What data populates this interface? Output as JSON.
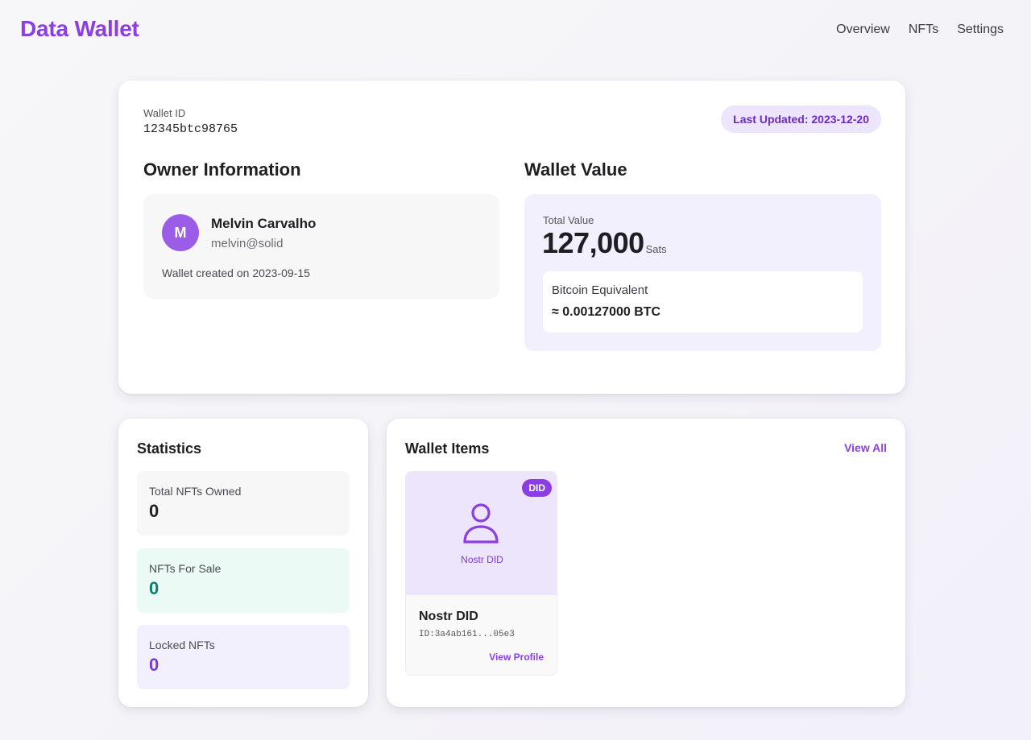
{
  "header": {
    "brand": "Data Wallet",
    "nav": [
      "Overview",
      "NFTs",
      "Settings"
    ]
  },
  "wallet": {
    "id_label": "Wallet ID",
    "id_value": "12345btc98765",
    "last_updated": "Last Updated: 2023-12-20"
  },
  "owner": {
    "section_title": "Owner Information",
    "avatar_initial": "M",
    "name": "Melvin Carvalho",
    "email": "melvin@solid",
    "created": "Wallet created on 2023-09-15"
  },
  "value": {
    "section_title": "Wallet Value",
    "total_label": "Total Value",
    "total_amount": "127,000",
    "unit": "Sats",
    "btc_label": "Bitcoin Equivalent",
    "btc_value": "≈ 0.00127000 BTC"
  },
  "statistics": {
    "title": "Statistics",
    "items": [
      {
        "label": "Total NFTs Owned",
        "value": "0"
      },
      {
        "label": "NFTs For Sale",
        "value": "0"
      },
      {
        "label": "Locked NFTs",
        "value": "0"
      }
    ]
  },
  "wallet_items": {
    "title": "Wallet Items",
    "view_all": "View All",
    "items": [
      {
        "badge": "DID",
        "icon": "person-icon",
        "caption": "Nostr DID",
        "name": "Nostr DID",
        "id": "ID:3a4ab161...05e3",
        "action": "View Profile"
      }
    ]
  },
  "colors": {
    "accent": "#8b3fe0",
    "for_sale": "#0f7d6d",
    "locked": "#7c3ad6"
  }
}
